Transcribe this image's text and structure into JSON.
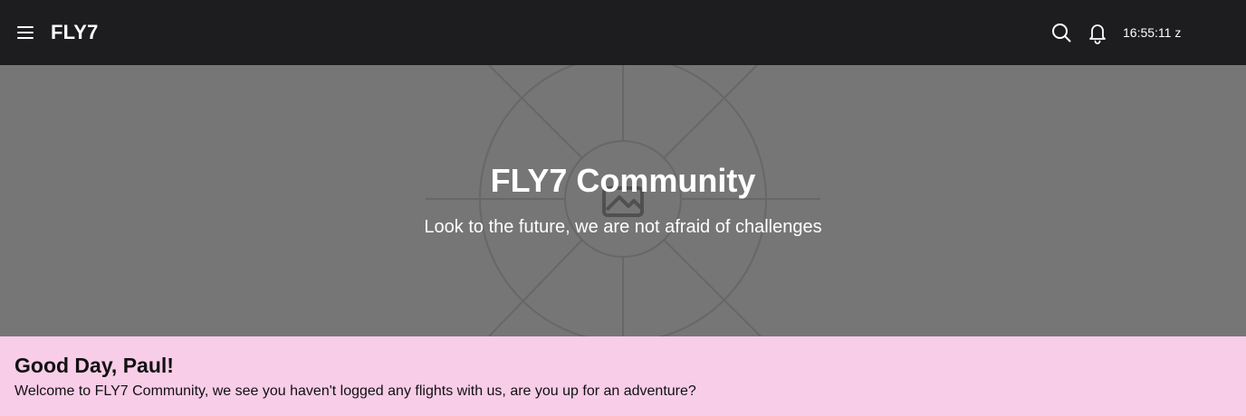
{
  "header": {
    "brand": "FLY7",
    "menu_icon": "hamburger-menu-icon",
    "search_icon": "search-icon",
    "notification_icon": "bell-icon",
    "clock": "16:55:11 z"
  },
  "hero": {
    "title": "FLY7 Community",
    "subtitle": "Look to the future, we are not afraid of challenges",
    "placeholder_icon": "image-placeholder-icon",
    "background_color": "#767676"
  },
  "greeting": {
    "title": "Good Day, Paul!",
    "message": "Welcome to FLY7 Community, we see you haven't logged any flights with us, are you up for an adventure?",
    "background_color": "#f8cde8"
  },
  "colors": {
    "topbar": "#1d1d1f",
    "text_light": "#ffffff",
    "text_dark": "#111111"
  }
}
